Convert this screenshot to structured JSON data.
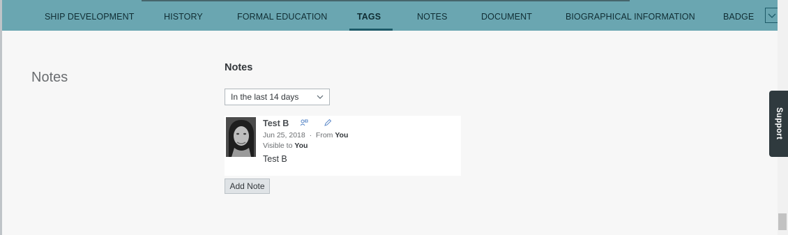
{
  "nav": {
    "tabs": [
      {
        "label": "SHIP DEVELOPMENT"
      },
      {
        "label": "HISTORY"
      },
      {
        "label": "FORMAL EDUCATION"
      },
      {
        "label": "TAGS",
        "active": true
      },
      {
        "label": "NOTES"
      },
      {
        "label": "DOCUMENT"
      },
      {
        "label": "BIOGRAPHICAL INFORMATION"
      },
      {
        "label": "BADGE"
      }
    ],
    "overflow_icon": "chevron-down-icon"
  },
  "section": {
    "title": "Notes"
  },
  "notes": {
    "heading": "Notes",
    "filter": {
      "selected": "In the last 14 days"
    },
    "items": [
      {
        "author": "Test B",
        "date": "Jun 25, 2018",
        "separator": "·",
        "from_label": "From",
        "from_value": "You",
        "visible_label": "Visible to",
        "visible_value": "You",
        "body": "Test B",
        "icons": [
          "visibility-icon",
          "edit-pencil-icon"
        ]
      }
    ],
    "add_label": "Add Note"
  },
  "support": {
    "label": "Support"
  },
  "colors": {
    "nav_bg": "#6aa6b1",
    "active_underline": "#1d5a68",
    "page_bg": "#f7f7f7",
    "support_bg": "#2f3a3e"
  }
}
